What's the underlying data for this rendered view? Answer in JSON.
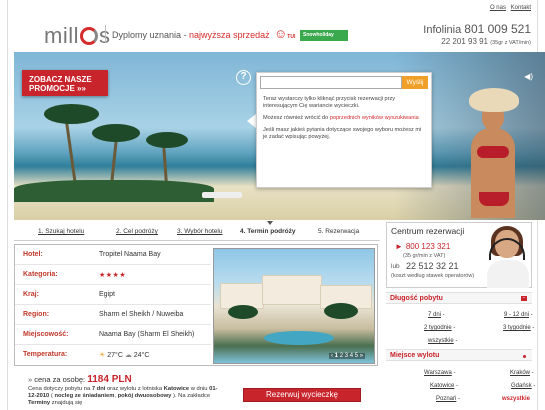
{
  "header": {
    "topnav": [
      "O nas",
      "Kontakt"
    ],
    "logo_text": [
      "mill",
      "s"
    ],
    "tagline_prefix": "Dyplomy uznania - ",
    "tagline_highlight": "najwyższa sprzedaż",
    "tui": "TUI",
    "tui_small": "TUI",
    "partner": "Snowholiday",
    "hotline_label": "Infolinia",
    "hotline_number": "801 009 521",
    "hotline_alt": "22 201 93 91",
    "hotline_note": "(35gr z VAT/min)"
  },
  "hero": {
    "promo_label": "ZOBACZ NASZE PROMOCJE »»",
    "help_icon": "?",
    "search_placeholder": "",
    "search_button": "Wyślij",
    "tips": [
      "Teraz wystarczy tylko kliknąć przycisk rezerwacji przy interesującym Cię wariancie wycieczki.",
      "Możesz również wrócić do ",
      "poprzednich wyników wyszukiwania",
      "Jeśli masz jakieś pytania dotyczące swojego wyboru możesz mi je zadać wpisując powyżej."
    ],
    "sound_icon": "◀)"
  },
  "steps": [
    {
      "label": "1. Szukaj hotelu"
    },
    {
      "label": "2. Cel podróży"
    },
    {
      "label": "3. Wybór hotelu"
    },
    {
      "label": "4. Termin podróży"
    },
    {
      "label": "5. Rezerwacja"
    }
  ],
  "hotel": {
    "rows": [
      {
        "label": "Hotel:",
        "value": "Tropitel Naama Bay"
      },
      {
        "label": "Kategoria:",
        "value": "★★★★"
      },
      {
        "label": "Kraj:",
        "value": "Egipt"
      },
      {
        "label": "Region:",
        "value": "Sharm el Sheikh / Nuweiba"
      },
      {
        "label": "Miejscowość:",
        "value": "Naama Bay (Sharm El Sheikh)"
      },
      {
        "label": "Temperatura:",
        "value": ""
      }
    ],
    "temp_day": "27°C",
    "temp_night": "24°C",
    "gallery_pages": [
      "1",
      "2",
      "3",
      "4",
      "5"
    ],
    "gallery_prev": "‹",
    "gallery_next": "»"
  },
  "price": {
    "label": "cena za osobę:",
    "value": "1184 PLN",
    "info_1": "Cena dotyczy pobytu na ",
    "nights": "7 dni",
    "info_2": " oraz wylotu z lotniska ",
    "airport": "Katowice",
    "info_3": " w dniu ",
    "date": "01-12-2010",
    "info_4": " ( ",
    "board": "nocleg ze śniadaniem",
    "info_5": ", ",
    "room": "pokój dwuosobowy",
    "info_6": " ). Na zakładce ",
    "tab": "Terminy",
    "info_7": " znajdują się",
    "book_button": "Rezerwuj wycieczkę"
  },
  "center": {
    "title": "Centrum rezerwacji",
    "phone1": "800 123 321",
    "phone1_note": "(35 gr/min z VAT)",
    "or": "lub",
    "phone2": "22 512 32 21",
    "phone2_note": "(koszt według stawek operatorów)"
  },
  "duration": {
    "title": "Długość pobytu",
    "items": [
      "7 dni",
      "9 - 12 dni",
      "2 tygodnie",
      "3 tygodnie",
      "wszystkie"
    ]
  },
  "departure": {
    "title": "Miejsce wylotu",
    "items": [
      "Warszawa",
      "Kraków",
      "Katowice",
      "Gdańsk",
      "Poznań",
      "wszystkie"
    ]
  },
  "colors": {
    "brand_red": "#c8242b",
    "orange": "#f0a028"
  }
}
